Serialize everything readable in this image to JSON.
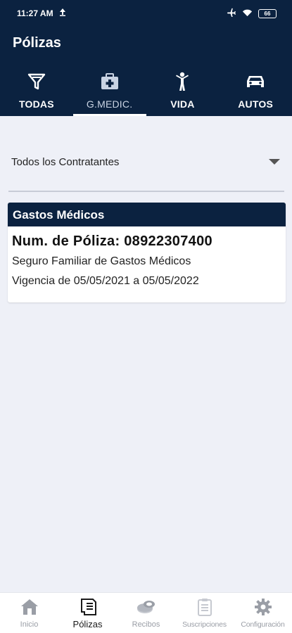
{
  "status_bar": {
    "time": "11:27 AM",
    "battery": "66"
  },
  "header": {
    "title": "Pólizas"
  },
  "tabs": [
    {
      "label": "TODAS",
      "icon": "filter-icon",
      "active": false
    },
    {
      "label": "G.MEDIC.",
      "icon": "medical-kit-icon",
      "active": true
    },
    {
      "label": "VIDA",
      "icon": "person-icon",
      "active": false
    },
    {
      "label": "AUTOS",
      "icon": "car-icon",
      "active": false
    }
  ],
  "contractor_select": {
    "value": "Todos los Contratantes"
  },
  "policy_card": {
    "category": "Gastos Médicos",
    "policy_number": "Num. de Póliza: 08922307400",
    "product": "Seguro Familiar de Gastos Médicos",
    "validity": "Vigencia de 05/05/2021 a 05/05/2022"
  },
  "bottom_nav": [
    {
      "label": "Inicio",
      "icon": "home-icon",
      "active": false
    },
    {
      "label": "Pólizas",
      "icon": "policy-document-icon",
      "active": true
    },
    {
      "label": "Recibos",
      "icon": "receipt-coins-icon",
      "active": false
    },
    {
      "label": "Suscripciones",
      "icon": "clipboard-icon",
      "active": false
    },
    {
      "label": "Configuración",
      "icon": "gear-icon",
      "active": false
    }
  ],
  "colors": {
    "header_bg": "#0b2240",
    "page_bg": "#eef0f7",
    "card_bg": "#ffffff",
    "nav_inactive": "#9a9ea6"
  }
}
